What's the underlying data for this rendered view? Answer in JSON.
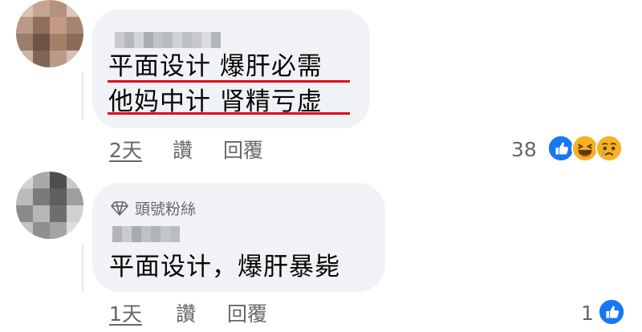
{
  "comments": [
    {
      "lines": [
        "平面设计  爆肝必需",
        "他妈中计  肾精亏虚"
      ],
      "time": "2天",
      "action_like": "讚",
      "action_reply": "回覆",
      "reaction_count": "38",
      "reactions": [
        "like-reaction",
        "haha-reaction",
        "sad-reaction"
      ]
    },
    {
      "badge": "頭號粉絲",
      "badge_icon": "diamond-icon",
      "text": "平面设计，爆肝暴毙",
      "time": "1天",
      "action_like": "讚",
      "action_reply": "回覆",
      "reaction_count": "1",
      "reactions": [
        "like-reaction"
      ]
    }
  ],
  "colors": {
    "bubble": "#f0f2f5",
    "underline": "#e0061a",
    "meta": "#65676b",
    "like_blue": "#1877f2"
  }
}
